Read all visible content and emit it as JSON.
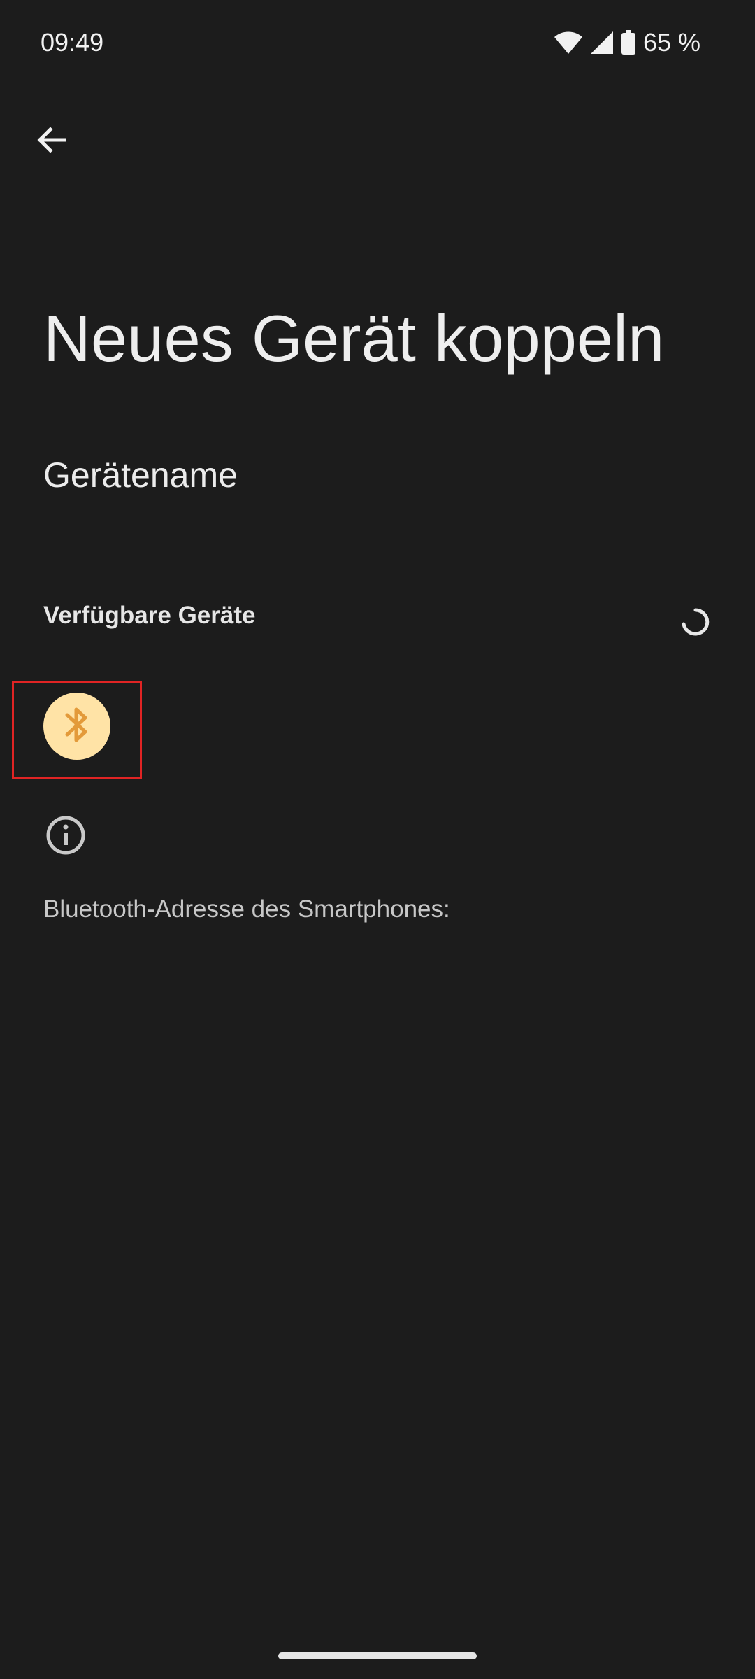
{
  "status_bar": {
    "time": "09:49",
    "battery_percent": "65 %",
    "icons": [
      "wifi-icon",
      "cell-signal-icon",
      "battery-icon"
    ]
  },
  "header": {
    "back_icon": "arrow-left-icon"
  },
  "page": {
    "title": "Neues Gerät koppeln",
    "device_name_label": "Gerätename"
  },
  "available_devices": {
    "header": "Verfügbare Geräte",
    "loading_icon": "spinner-icon",
    "device_icon": "bluetooth-icon"
  },
  "info": {
    "icon": "info-icon",
    "bluetooth_address_label": "Bluetooth-Adresse des Smartphones:"
  },
  "colors": {
    "background": "#1c1c1c",
    "bluetooth_circle": "#ffe3a6",
    "bluetooth_glyph": "#e39a3a",
    "highlight_border": "#e02424"
  }
}
